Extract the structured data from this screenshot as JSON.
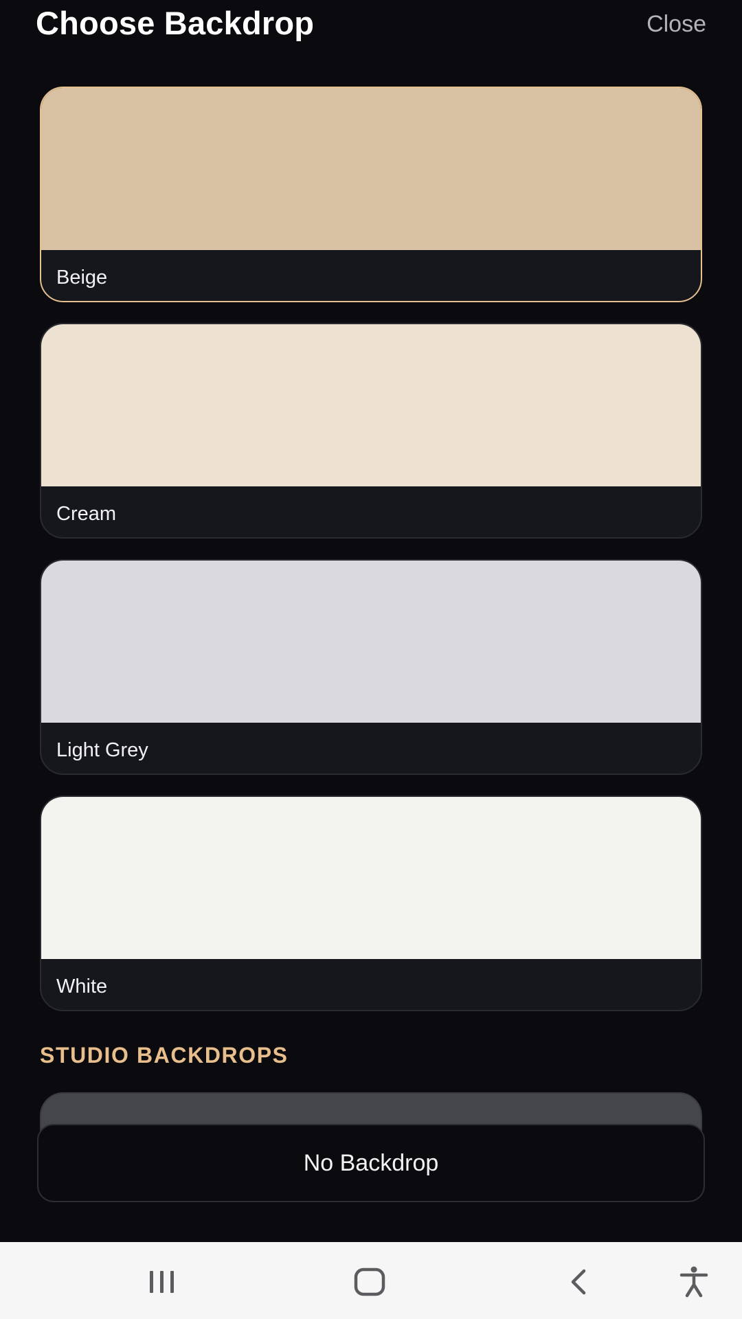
{
  "header": {
    "title": "Choose Backdrop",
    "close_label": "Close"
  },
  "backdrops": [
    {
      "label": "Beige",
      "color": "#d9c2a3",
      "selected": true
    },
    {
      "label": "Cream",
      "color": "#ede2d2",
      "selected": false
    },
    {
      "label": "Light Grey",
      "color": "#d9d9de",
      "selected": false
    },
    {
      "label": "White",
      "color": "#f3f3f0",
      "selected": false
    }
  ],
  "section": {
    "title": "STUDIO BACKDROPS"
  },
  "footer": {
    "no_backdrop_label": "No Backdrop"
  },
  "colors": {
    "accent": "#e6c08e",
    "background": "#0b0b0f",
    "card": "#16171d"
  },
  "navbar": {
    "icons": [
      "recent-apps-icon",
      "home-icon",
      "back-icon",
      "accessibility-icon"
    ]
  }
}
